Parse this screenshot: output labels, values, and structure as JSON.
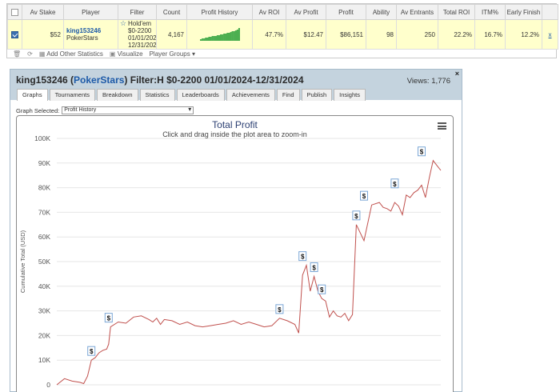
{
  "table": {
    "headers": [
      "",
      "Av Stake",
      "Player",
      "Filter",
      "Count",
      "Profit History",
      "Av ROI",
      "Av Profit",
      "Profit",
      "Ability",
      "Av Entrants",
      "Total ROI",
      "ITM%",
      "Early Finish",
      ""
    ],
    "row": {
      "av_stake": "$52",
      "player_name": "king153246",
      "player_site": "PokerStars",
      "filter_lines": [
        "Hold'em",
        "$0-2200",
        "01/01/202",
        "12/31/202"
      ],
      "count": "4,167",
      "av_roi": "47.7%",
      "av_profit": "$12.47",
      "profit": "$86,151",
      "ability": "98",
      "av_entrants": "250",
      "total_roi": "22.2%",
      "itm": "16.7%",
      "early_finish": "12.2%",
      "remove": "x"
    },
    "spark_values": [
      2,
      3,
      3,
      4,
      4,
      5,
      5,
      6,
      6,
      6,
      7,
      7,
      8,
      8,
      9,
      9,
      10,
      10,
      11,
      12,
      12,
      13,
      14,
      16
    ]
  },
  "toolbar": {
    "add_other": "Add Other Statistics",
    "visualize": "Visualize",
    "player_groups": "Player Groups"
  },
  "panel": {
    "title_prefix": "king153246 (",
    "site": "PokerStars",
    "title_suffix": ") Filter:H $0-2200 01/01/2024-12/31/2024",
    "views": "Views: 1,776",
    "close": "×",
    "tabs": [
      "Graphs",
      "Tournaments",
      "Breakdown",
      "Statistics",
      "Leaderboards",
      "Achievements",
      "Find",
      "Publish",
      "Insights"
    ],
    "graph_selected_label": "Graph Selected:",
    "graph_selected_value": "Profit History"
  },
  "chart_data": {
    "type": "line",
    "title": "Total Profit",
    "subtitle": "Click and drag inside the plot area to zoom-in",
    "ylabel": "Cumulative Total (USD)",
    "ylim": [
      0,
      100000
    ],
    "yticks": [
      "0",
      "10K",
      "20K",
      "30K",
      "40K",
      "50K",
      "60K",
      "70K",
      "80K",
      "90K",
      "100K"
    ],
    "grid": true,
    "color": "#c0504d",
    "x": [
      0,
      2,
      4,
      6,
      7,
      8,
      9,
      10,
      11,
      12,
      13,
      13.5,
      14,
      16,
      18,
      20,
      22,
      24,
      25,
      26,
      27,
      28,
      30,
      32,
      34,
      36,
      38,
      40,
      42,
      44,
      46,
      48,
      50,
      52,
      54,
      56,
      58,
      60,
      62,
      63,
      64,
      65,
      66,
      67,
      68,
      69,
      70,
      71,
      72,
      73,
      74,
      75,
      76,
      77,
      78,
      80,
      82,
      84,
      85,
      86,
      87,
      88,
      89,
      90,
      91,
      92,
      93,
      94,
      95,
      96,
      97,
      98,
      99,
      100
    ],
    "values": [
      0,
      2500,
      1500,
      1000,
      500,
      3500,
      10000,
      11000,
      13000,
      14000,
      14500,
      16500,
      23500,
      25500,
      25000,
      27500,
      28000,
      26500,
      25500,
      27000,
      24500,
      26500,
      26000,
      24500,
      25500,
      24000,
      23500,
      24000,
      24500,
      25000,
      26000,
      24500,
      25500,
      24500,
      23500,
      24000,
      27000,
      26000,
      24500,
      21000,
      44500,
      48500,
      38000,
      44000,
      38000,
      35000,
      34000,
      27500,
      30000,
      28000,
      27500,
      29000,
      26000,
      28500,
      65000,
      58500,
      73000,
      74000,
      72000,
      71500,
      70500,
      74000,
      72500,
      69000,
      77000,
      76000,
      78000,
      79000,
      81000,
      76000,
      84000,
      91000,
      89000,
      87000
    ],
    "annotations": [
      {
        "label": "$",
        "x": 9,
        "y": 10000
      },
      {
        "label": "$",
        "x": 13.5,
        "y": 23500
      },
      {
        "label": "$",
        "x": 58,
        "y": 27000
      },
      {
        "label": "$",
        "x": 64,
        "y": 48500
      },
      {
        "label": "$",
        "x": 67,
        "y": 44000
      },
      {
        "label": "$",
        "x": 69,
        "y": 35000
      },
      {
        "label": "$",
        "x": 78,
        "y": 65000
      },
      {
        "label": "$",
        "x": 80,
        "y": 73000
      },
      {
        "label": "$",
        "x": 88,
        "y": 78000
      },
      {
        "label": "$",
        "x": 95,
        "y": 91000
      }
    ]
  }
}
